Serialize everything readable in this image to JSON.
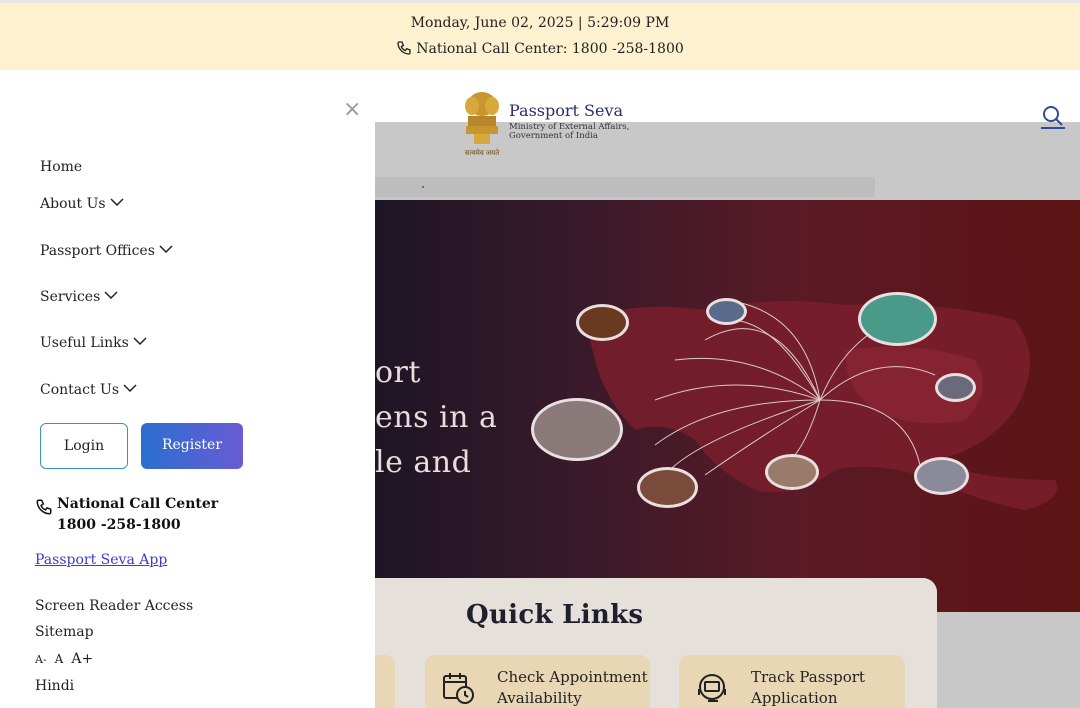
{
  "topbar": {
    "datetime": "Monday, June 02, 2025 | 5:29:09 PM",
    "call_center": "National Call Center: 1800 -258-1800"
  },
  "header": {
    "brand": "Passport Seva",
    "brand_sub_1": "Ministry of External Affairs,",
    "brand_sub_2": "Government of India",
    "emblem_motto": "सत्यमेव जयते"
  },
  "drawer": {
    "close_label": "×",
    "nav": [
      {
        "label": "Home"
      },
      {
        "label": "About Us"
      },
      {
        "label": "Passport Offices"
      },
      {
        "label": "Services"
      },
      {
        "label": "Useful Links"
      },
      {
        "label": "Contact Us"
      }
    ],
    "login_label": "Login",
    "register_label": "Register",
    "ncc_title": "National Call Center",
    "ncc_number": "1800 -258-1800",
    "app_link": "Passport Seva App",
    "screen_reader": "Screen Reader Access",
    "sitemap": "Sitemap",
    "font_small": "A-",
    "font_normal": "A",
    "font_large": "A+",
    "language": "Hindi"
  },
  "hero": {
    "line1": "ort",
    "line2": "ens in a",
    "line3": "le and"
  },
  "quick_links": {
    "title": "Quick Links",
    "cards": [
      {
        "line1": "Check Appointment",
        "line2": "Availability",
        "icon": "calendar-clock-icon"
      },
      {
        "line1": "Track Passport",
        "line2": "Application",
        "icon": "track-support-icon"
      }
    ]
  },
  "colors": {
    "topbar_bg": "#fdf1cf",
    "register_btn": "#2a6fd0",
    "link": "#3b3bd0",
    "hero_dark": "#5d1414",
    "quicklink_card": "#e8d6b4"
  }
}
